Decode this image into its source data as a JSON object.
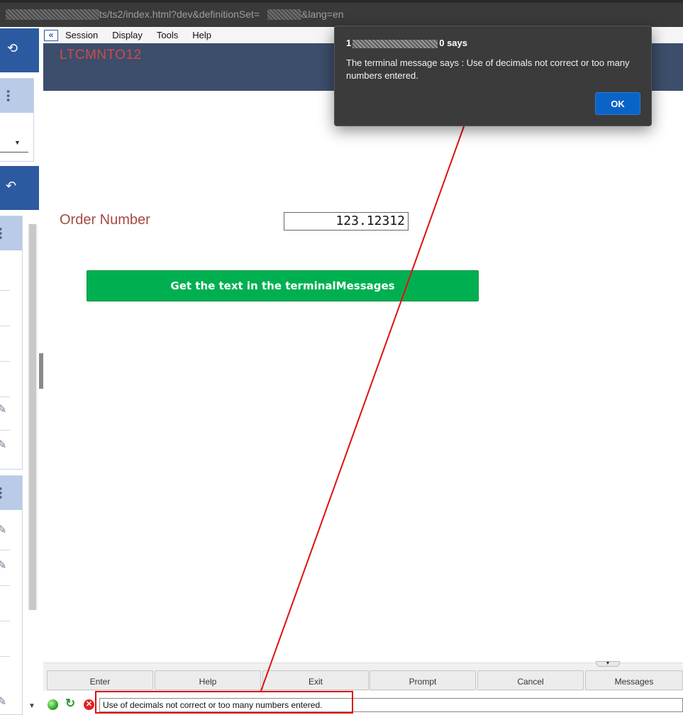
{
  "address_bar": {
    "url_part1": "ts/ts2/index.html?dev&definitionSet=",
    "url_part2": "&lang=en"
  },
  "menubar": {
    "items": [
      "Session",
      "Display",
      "Tools",
      "Help"
    ],
    "collapse_icon": "double-chevron-left-icon"
  },
  "header": {
    "screen_id": "LTCMNTO12"
  },
  "form": {
    "order_label": "Order Number",
    "order_value": "123.12312",
    "action_button": "Get the text in the terminalMessages"
  },
  "function_keys": [
    "Enter",
    "Help",
    "Exit",
    "Prompt",
    "Cancel",
    "Messages"
  ],
  "status_bar": {
    "message": "Use of decimals not correct or too many numbers entered.",
    "icons": [
      "connected-icon",
      "refresh-icon",
      "error-icon"
    ]
  },
  "dialog": {
    "origin_prefix": "1",
    "origin_suffix": "0 says",
    "message": "The terminal message says : Use of decimals not correct or too many numbers entered.",
    "ok_label": "OK"
  },
  "annotation": {
    "color": "#e01010"
  },
  "colors": {
    "header_bg": "#3c4e6b",
    "screen_id": "#d04a4a",
    "field_label": "#a54a42",
    "action_button": "#00b050",
    "ok_button": "#0a64c8"
  }
}
